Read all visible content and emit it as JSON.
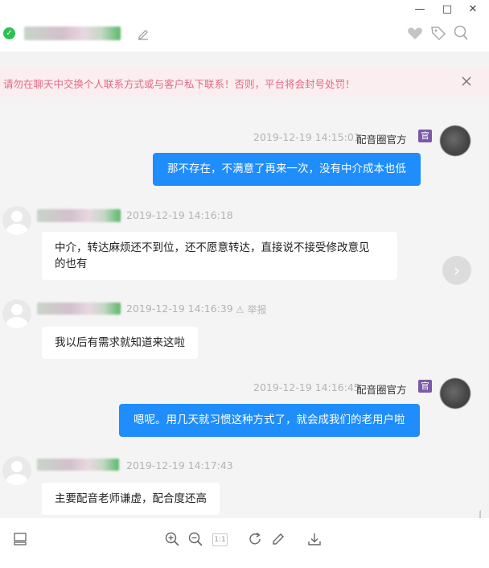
{
  "window": {
    "minimize": "—",
    "maximize": "□",
    "close": "✕"
  },
  "header": {
    "status_icon": "check-circle-icon",
    "status_mark": "✓",
    "icons": [
      "heart-icon",
      "tag-icon",
      "search-icon"
    ]
  },
  "warning": {
    "text": "请勿在聊天中交换个人联系方式或与客户私下联系！否则，平台将会封号处罚！",
    "color": "#e26a82"
  },
  "messages": [
    {
      "side": "right",
      "time": "2019-12-19 14:15:01",
      "sender": "配音圈官方",
      "badge": "官",
      "text": "那不存在，不满意了再来一次，没有中介成本也低"
    },
    {
      "side": "left",
      "time": "2019-12-19 14:16:18",
      "text_lines": [
        "中介，转达麻烦还不到位，还不愿意转达，直接说不接受修改意见",
        "的也有"
      ]
    },
    {
      "side": "left",
      "time": "2019-12-19 14:16:39",
      "report": "举报",
      "text": "我以后有需求就知道来这啦"
    },
    {
      "side": "right",
      "time": "2019-12-19 14:16:45",
      "sender": "配音圈官方",
      "badge": "官",
      "text": "嗯呢。用几天就习惯这种方式了，就会成我们的老用户啦"
    },
    {
      "side": "left",
      "time": "2019-12-19 14:17:43",
      "text": "主要配音老师谦虚，配合度还高"
    }
  ],
  "next_arrow": "›",
  "toolbar": {
    "icons": [
      "layout-icon",
      "zoom-in-icon",
      "zoom-out-icon",
      "actual-size-icon",
      "rotate-icon",
      "edit-icon",
      "download-icon"
    ],
    "actual_size_label": "1:1"
  },
  "colors": {
    "accent": "#1f8dfb",
    "badge": "#7a5aa8",
    "online": "#2fbf57"
  }
}
